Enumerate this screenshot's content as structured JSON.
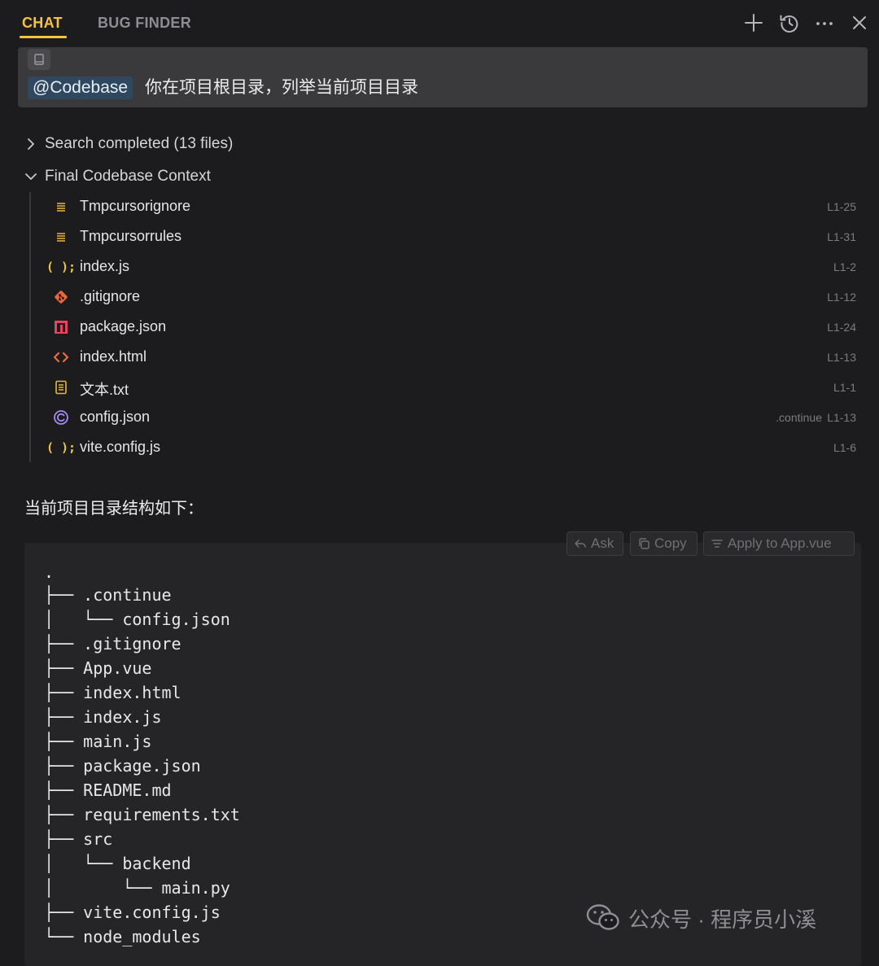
{
  "header": {
    "tabs": [
      {
        "label": "CHAT",
        "active": true
      },
      {
        "label": "BUG FINDER",
        "active": false
      }
    ],
    "icons": [
      "plus-icon",
      "history-icon",
      "more-icon",
      "close-icon"
    ],
    "accent_color": "#f5c242"
  },
  "query": {
    "mention": "@Codebase",
    "text": "你在项目根目录，列举当前项目目录"
  },
  "context": {
    "search_label": "Search completed (13 files)",
    "final_label": "Final Codebase Context",
    "files": [
      {
        "name": "Tmpcursorignore",
        "icon": "text-lines-icon",
        "range": "L1-25",
        "path": ""
      },
      {
        "name": "Tmpcursorrules",
        "icon": "text-lines-icon",
        "range": "L1-31",
        "path": ""
      },
      {
        "name": "index.js",
        "icon": "js-icon",
        "range": "L1-2",
        "path": ""
      },
      {
        "name": ".gitignore",
        "icon": "git-icon",
        "range": "L1-12",
        "path": ""
      },
      {
        "name": "package.json",
        "icon": "npm-icon",
        "range": "L1-24",
        "path": ""
      },
      {
        "name": "index.html",
        "icon": "html-icon",
        "range": "L1-13",
        "path": ""
      },
      {
        "name": "文本.txt",
        "icon": "txt-file-icon",
        "range": "L1-1",
        "path": ""
      },
      {
        "name": "config.json",
        "icon": "continue-icon",
        "range": "L1-13",
        "path": ".continue"
      },
      {
        "name": "vite.config.js",
        "icon": "js-icon",
        "range": "L1-6",
        "path": ""
      }
    ]
  },
  "response": {
    "intro": "当前项目目录结构如下："
  },
  "code": {
    "buttons": {
      "ask": "Ask",
      "copy": "Copy",
      "apply": "Apply to App.vue"
    },
    "lines": [
      ".",
      "├── .continue",
      "│   └── config.json",
      "├── .gitignore",
      "├── App.vue",
      "├── index.html",
      "├── index.js",
      "├── main.js",
      "├── package.json",
      "├── README.md",
      "├── requirements.txt",
      "├── src",
      "│   └── backend",
      "│       └── main.py",
      "├── vite.config.js",
      "└── node_modules"
    ]
  },
  "watermark": {
    "text": "公众号 · 程序员小溪"
  }
}
